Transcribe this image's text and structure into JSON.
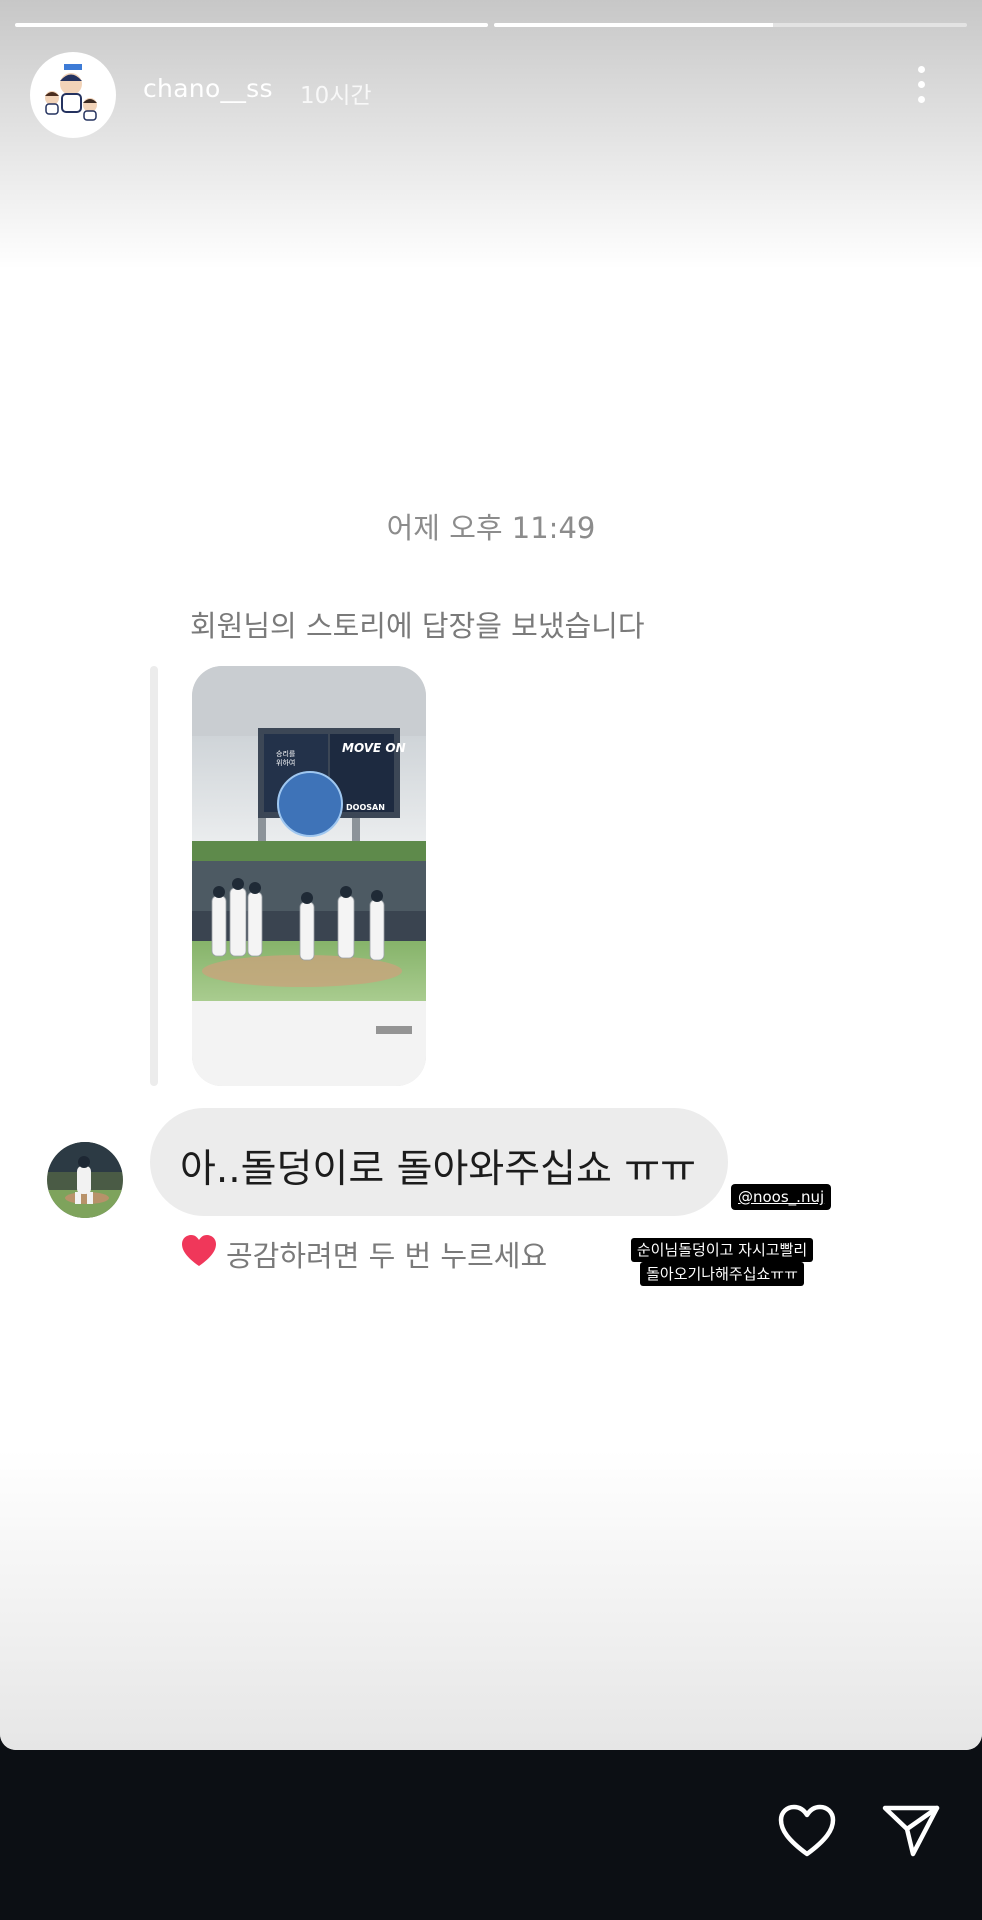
{
  "story": {
    "progress_segments": [
      {
        "label": "segment-1",
        "fill": 1.0
      },
      {
        "label": "segment-2",
        "fill": 0.59
      }
    ],
    "username": "chano__ss",
    "time_ago": "10시간"
  },
  "chat": {
    "timestamp": "어제 오후 11:49",
    "reply_note": "회원님의 스토리에 답장을 보냈습니다",
    "message": "아..돌덩이로 돌아와주십쇼 ㅠㅠ",
    "like_hint": "공감하려면 두 번 누르세요"
  },
  "thumbnail": {
    "billboard_left": "승리를\n위하여",
    "billboard_right": "MOVE ON",
    "billboard_brand": "DOOSAN"
  },
  "overlay": {
    "mention": "@noos_.nuj",
    "caption_lines": [
      "순이님돌덩이고 자시고빨리",
      "돌아오기나해주십쇼ㅠㅠ"
    ]
  },
  "colors": {
    "background_dark": "#0c0f14",
    "heart_pink": "#f0375a",
    "bubble_gray": "#ececec"
  },
  "icons": {
    "more": "more-vertical-icon",
    "like": "heart-outline-icon",
    "send": "send-icon",
    "reaction": "heart-filled-icon"
  }
}
